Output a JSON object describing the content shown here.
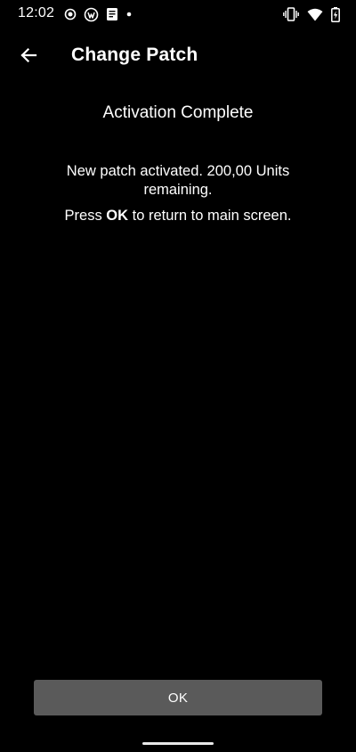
{
  "status_bar": {
    "time": "12:02",
    "left_icons": [
      "record-icon",
      "vpn-key-icon",
      "document-icon",
      "dot-icon"
    ],
    "right_icons": [
      "vibrate-icon",
      "wifi-icon",
      "battery-charging-icon"
    ]
  },
  "app_bar": {
    "back_icon": "arrow-back-icon",
    "title": "Change Patch"
  },
  "content": {
    "heading": "Activation Complete",
    "message": "New patch activated. 200,00 Units remaining.",
    "instruction_prefix": "Press ",
    "instruction_strong": "OK",
    "instruction_suffix": " to return to main screen."
  },
  "actions": {
    "ok_label": "OK"
  },
  "colors": {
    "background": "#000000",
    "text": "#ffffff",
    "button": "#5a5a5a",
    "gesture_bar": "#e8e8e8"
  }
}
